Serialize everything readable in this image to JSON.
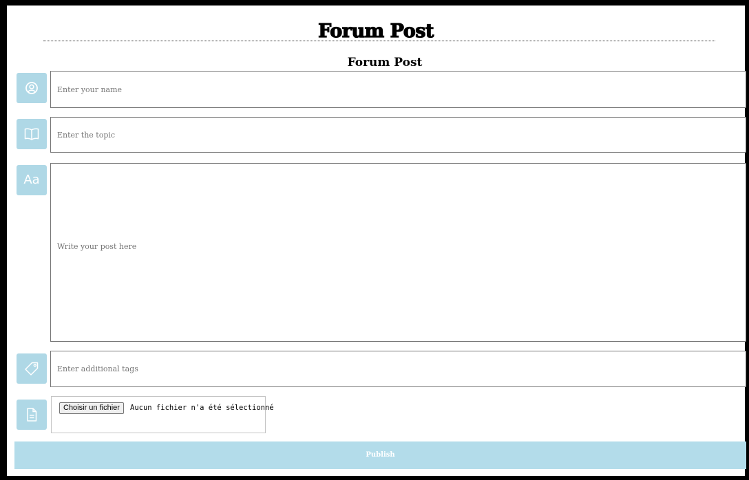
{
  "header": {
    "title": "Forum Post"
  },
  "form": {
    "title": "Forum Post",
    "name_placeholder": "Enter your name",
    "topic_placeholder": "Enter the topic",
    "post_placeholder": "Write your post here",
    "tags_placeholder": "Enter additional tags",
    "file_button_label": "Choisir un fichier",
    "file_status": "Aucun fichier n'a été sélectionné",
    "publish_label": "Publish",
    "text_icon_label": "Aa"
  },
  "colors": {
    "icon_bg": "#afd8e6",
    "publish_bg": "#b3dcea",
    "frame_border": "#000000"
  },
  "icons": [
    "user-circle-icon",
    "open-book-icon",
    "text-format-icon",
    "tag-icon",
    "document-icon"
  ]
}
